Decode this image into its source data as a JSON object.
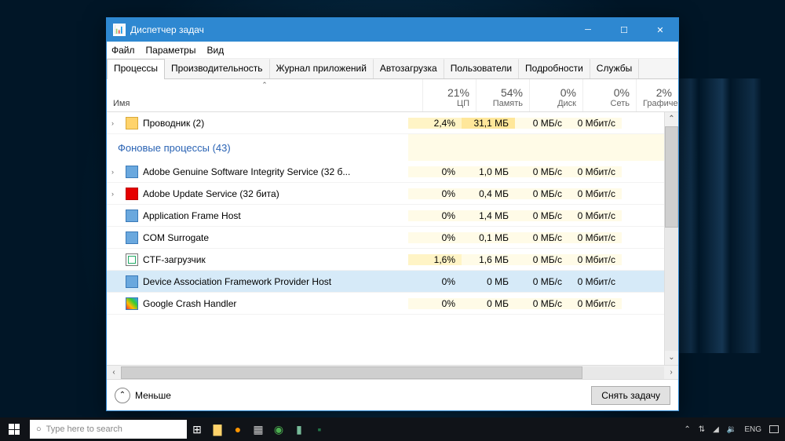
{
  "titlebar": {
    "title": "Диспетчер задач"
  },
  "menu": [
    "Файл",
    "Параметры",
    "Вид"
  ],
  "tabs": [
    "Процессы",
    "Производительность",
    "Журнал приложений",
    "Автозагрузка",
    "Пользователи",
    "Подробности",
    "Службы"
  ],
  "active_tab": 0,
  "columns": {
    "name_label": "Имя",
    "cols": [
      {
        "pct": "21%",
        "label": "ЦП"
      },
      {
        "pct": "54%",
        "label": "Память"
      },
      {
        "pct": "0%",
        "label": "Диск"
      },
      {
        "pct": "0%",
        "label": "Сеть"
      },
      {
        "pct": "2%",
        "label": "Графиче"
      }
    ]
  },
  "group_header": "Фоновые процессы (43)",
  "processes": [
    {
      "name": "Проводник (2)",
      "icon": "folder",
      "expandable": true,
      "cpu": "2,4%",
      "mem": "31,1 МБ",
      "disk": "0 МБ/с",
      "net": "0 Мбит/с",
      "cpu_heat": "y1",
      "mem_heat": "y2",
      "disk_heat": "y0",
      "net_heat": "y0"
    },
    {
      "name": "Adobe Genuine Software Integrity Service (32 б...",
      "icon": "generic",
      "expandable": true,
      "cpu": "0%",
      "mem": "1,0 МБ",
      "disk": "0 МБ/с",
      "net": "0 Мбит/с",
      "cpu_heat": "y0",
      "mem_heat": "y0",
      "disk_heat": "y0",
      "net_heat": "y0"
    },
    {
      "name": "Adobe Update Service (32 бита)",
      "icon": "adobe",
      "expandable": true,
      "cpu": "0%",
      "mem": "0,4 МБ",
      "disk": "0 МБ/с",
      "net": "0 Мбит/с",
      "cpu_heat": "y0",
      "mem_heat": "y0",
      "disk_heat": "y0",
      "net_heat": "y0"
    },
    {
      "name": "Application Frame Host",
      "icon": "generic",
      "expandable": false,
      "cpu": "0%",
      "mem": "1,4 МБ",
      "disk": "0 МБ/с",
      "net": "0 Мбит/с",
      "cpu_heat": "y0",
      "mem_heat": "y0",
      "disk_heat": "y0",
      "net_heat": "y0"
    },
    {
      "name": "COM Surrogate",
      "icon": "generic",
      "expandable": false,
      "cpu": "0%",
      "mem": "0,1 МБ",
      "disk": "0 МБ/с",
      "net": "0 Мбит/с",
      "cpu_heat": "y0",
      "mem_heat": "y0",
      "disk_heat": "y0",
      "net_heat": "y0"
    },
    {
      "name": "CTF-загрузчик",
      "icon": "ctf",
      "expandable": false,
      "cpu": "1,6%",
      "mem": "1,6 МБ",
      "disk": "0 МБ/с",
      "net": "0 Мбит/с",
      "cpu_heat": "y1",
      "mem_heat": "y0",
      "disk_heat": "y0",
      "net_heat": "y0"
    },
    {
      "name": "Device Association Framework Provider Host",
      "icon": "generic",
      "expandable": false,
      "selected": true,
      "cpu": "0%",
      "mem": "0 МБ",
      "disk": "0 МБ/с",
      "net": "0 Мбит/с"
    },
    {
      "name": "Google Crash Handler",
      "icon": "google",
      "expandable": false,
      "cpu": "0%",
      "mem": "0 МБ",
      "disk": "0 МБ/с",
      "net": "0 Мбит/с",
      "cpu_heat": "y0",
      "mem_heat": "y0",
      "disk_heat": "y0",
      "net_heat": "y0"
    }
  ],
  "footer": {
    "less": "Меньше",
    "end_task": "Снять задачу"
  },
  "taskbar": {
    "search_placeholder": "Type here to search",
    "lang": "ENG"
  }
}
